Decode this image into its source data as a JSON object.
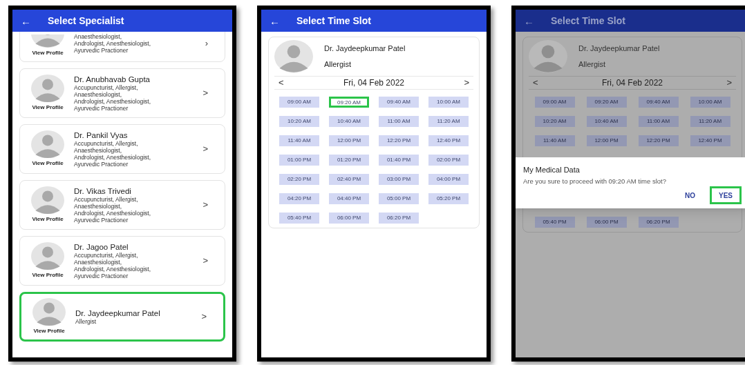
{
  "screens": [
    {
      "kind": "specialists",
      "title": "Select Specialist",
      "back": "←",
      "dimmed": false,
      "doctors": [
        {
          "lines": [
            "Anaesthesiologist,",
            "Andrologist, Anesthesiologist,",
            "Ayurvedic Practioner"
          ],
          "link": "View Profile",
          "chevron": "›",
          "partial": true,
          "highlighted": false
        },
        {
          "name": "Dr. Anubhavab Gupta",
          "lines": [
            "Accupuncturist, Allergist,",
            "Anaesthesiologist,",
            "Andrologist, Anesthesiologist,",
            "Ayurvedic Practioner"
          ],
          "link": "View Profile",
          "chevron": ">",
          "partial": false,
          "highlighted": false
        },
        {
          "name": "Dr. Pankil Vyas",
          "lines": [
            "Accupuncturist, Allergist,",
            "Anaesthesiologist,",
            "Andrologist, Anesthesiologist,",
            "Ayurvedic Practioner"
          ],
          "link": "View Profile",
          "chevron": ">",
          "partial": false,
          "highlighted": false
        },
        {
          "name": "Dr. Vikas Trivedi",
          "lines": [
            "Accupuncturist, Allergist,",
            "Anaesthesiologist,",
            "Andrologist, Anesthesiologist,",
            "Ayurvedic Practioner"
          ],
          "link": "View Profile",
          "chevron": ">",
          "partial": false,
          "highlighted": false
        },
        {
          "name": "Dr. Jagoo Patel",
          "lines": [
            "Accupuncturist, Allergist,",
            "Anaesthesiologist,",
            "Andrologist, Anesthesiologist,",
            "Ayurvedic Practioner"
          ],
          "link": "View Profile",
          "chevron": ">",
          "partial": false,
          "highlighted": false
        },
        {
          "name": "Dr. Jaydeepkumar Patel",
          "lines": [
            "Allergist"
          ],
          "link": "View Profile",
          "chevron": ">",
          "partial": false,
          "highlighted": true
        }
      ]
    },
    {
      "kind": "slots",
      "title": "Select Time Slot",
      "back": "←",
      "dimmed": false,
      "doctor": "Dr. Jaydeepkumar Patel",
      "specialty": "Allergist",
      "prev": "<",
      "date": "Fri, 04 Feb 2022",
      "next": ">",
      "slots_before": [
        {
          "label": "09:00 AM",
          "highlighted": false
        },
        {
          "label": "09:20 AM",
          "highlighted": true
        },
        {
          "label": "09:40 AM",
          "highlighted": false
        },
        {
          "label": "10:00 AM",
          "highlighted": false
        },
        {
          "label": "10:20 AM",
          "highlighted": false
        },
        {
          "label": "10:40 AM",
          "highlighted": false
        },
        {
          "label": "11:00 AM",
          "highlighted": false
        },
        {
          "label": "11:20 AM",
          "highlighted": false
        },
        {
          "label": "11:40 AM",
          "highlighted": false
        },
        {
          "label": "12:00 PM",
          "highlighted": false
        },
        {
          "label": "12:20 PM",
          "highlighted": false
        },
        {
          "label": "12:40 PM",
          "highlighted": false
        },
        {
          "label": "01:00 PM",
          "highlighted": false
        },
        {
          "label": "01:20 PM",
          "highlighted": false
        },
        {
          "label": "01:40 PM",
          "highlighted": false
        },
        {
          "label": "02:00 PM",
          "highlighted": false
        },
        {
          "label": "02:20 PM",
          "highlighted": false
        },
        {
          "label": "02:40 PM",
          "highlighted": false
        },
        {
          "label": "03:00 PM",
          "highlighted": false
        },
        {
          "label": "04:00 PM",
          "highlighted": false
        },
        {
          "label": "04:20 PM",
          "highlighted": false
        },
        {
          "label": "04:40 PM",
          "highlighted": false
        },
        {
          "label": "05:00 PM",
          "highlighted": false
        },
        {
          "label": "05:20 PM",
          "highlighted": false
        },
        {
          "label": "05:40 PM",
          "highlighted": false
        },
        {
          "label": "06:00 PM",
          "highlighted": false
        },
        {
          "label": "06:20 PM",
          "highlighted": false
        }
      ]
    },
    {
      "kind": "slots",
      "title": "Select Time Slot",
      "back": "←",
      "dimmed": true,
      "doctor": "Dr. Jaydeepkumar Patel",
      "specialty": "Allergist",
      "prev": "<",
      "date": "Fri, 04 Feb 2022",
      "next": ">",
      "slots_before": [
        {
          "label": "09:00 AM",
          "highlighted": false
        },
        {
          "label": "09:20 AM",
          "highlighted": false
        },
        {
          "label": "09:40 AM",
          "highlighted": false
        },
        {
          "label": "10:00 AM",
          "highlighted": false
        },
        {
          "label": "10:20 AM",
          "highlighted": false
        },
        {
          "label": "10:40 AM",
          "highlighted": false
        },
        {
          "label": "11:00 AM",
          "highlighted": false
        },
        {
          "label": "11:20 AM",
          "highlighted": false
        },
        {
          "label": "11:40 AM",
          "highlighted": false
        },
        {
          "label": "12:00 PM",
          "highlighted": false
        },
        {
          "label": "12:20 PM",
          "highlighted": false
        },
        {
          "label": "12:40 PM",
          "highlighted": false
        }
      ],
      "dialog": {
        "title": "My Medical Data",
        "message": "Are you sure to proceed with 09:20 AM time slot?",
        "buttons": [
          {
            "label": "NO",
            "highlighted": false
          },
          {
            "label": "YES",
            "highlighted": true
          }
        ]
      },
      "slots_after": [
        {
          "label": "05:40 PM",
          "highlighted": false
        },
        {
          "label": "06:00 PM",
          "highlighted": false
        },
        {
          "label": "06:20 PM",
          "highlighted": false
        }
      ]
    }
  ]
}
